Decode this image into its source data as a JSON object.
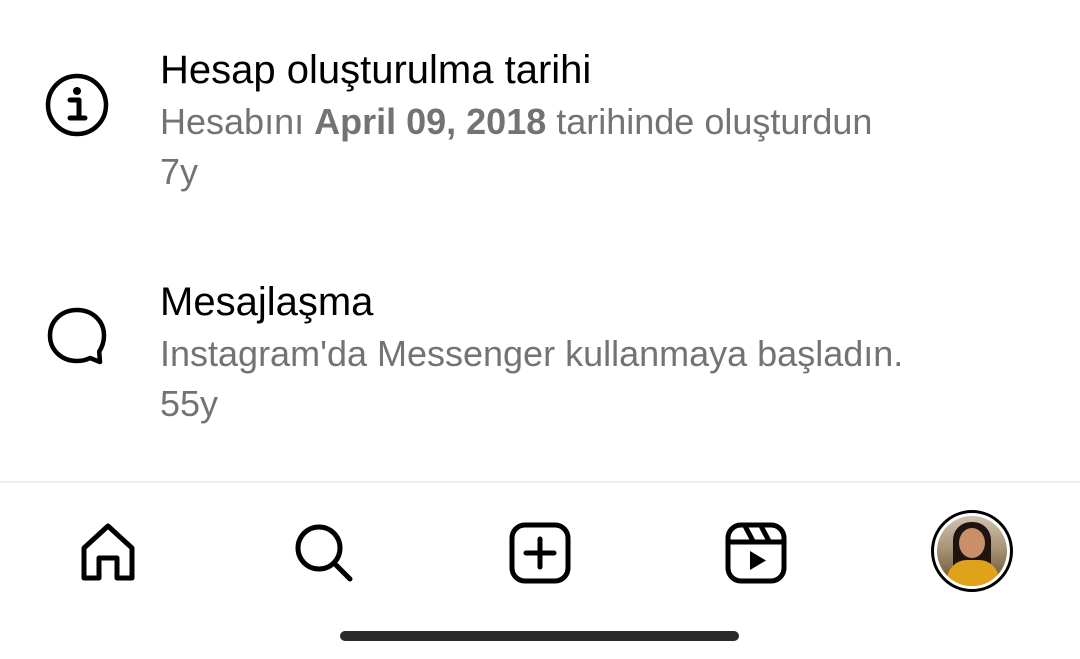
{
  "activity": {
    "items": [
      {
        "title": "Hesap oluşturulma tarihi",
        "desc_prefix": "Hesabını ",
        "desc_bold": "April 09, 2018",
        "desc_suffix": " tarihinde oluşturdun",
        "time": "7y",
        "icon": "info-icon"
      },
      {
        "title": "Mesajlaşma",
        "desc": "Instagram'da Messenger kullanmaya başladın.",
        "time": "55y",
        "icon": "message-bubble-icon"
      }
    ]
  },
  "tabbar": {
    "tabs": [
      "home-icon",
      "search-icon",
      "create-icon",
      "reels-icon",
      "profile-avatar"
    ]
  },
  "colors": {
    "text_primary": "#000000",
    "text_secondary": "#737373",
    "divider": "#efefef"
  }
}
